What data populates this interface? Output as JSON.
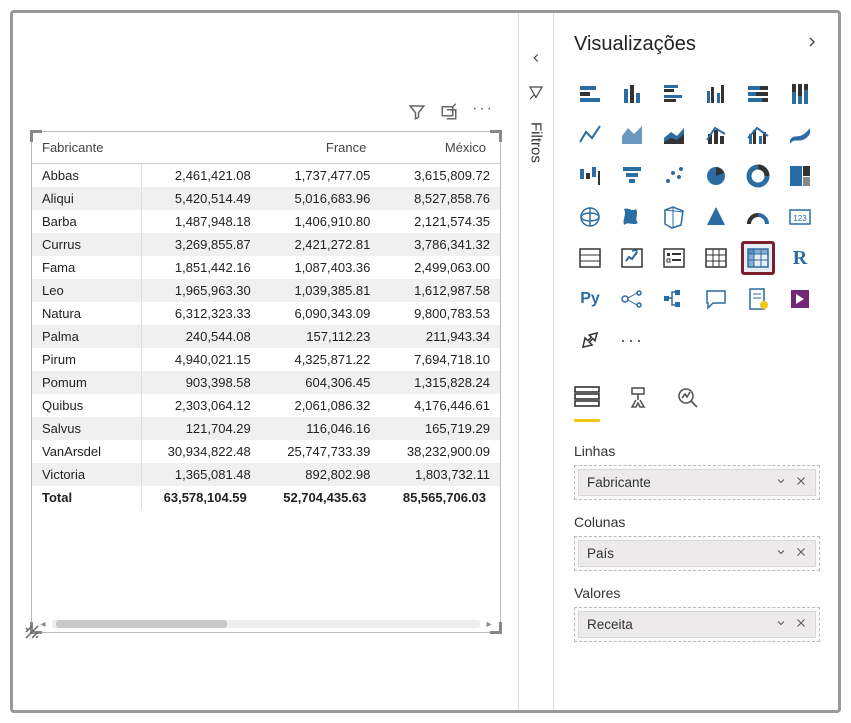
{
  "filtersTab": {
    "label": "Filtros"
  },
  "vizPane": {
    "title": "Visualizações",
    "tabs": {
      "fields": "Campos",
      "format": "Formato",
      "analytics": "Análise"
    },
    "sections": {
      "rows": {
        "label": "Linhas",
        "field": "Fabricante"
      },
      "cols": {
        "label": "Colunas",
        "field": "País"
      },
      "vals": {
        "label": "Valores",
        "field": "Receita"
      }
    }
  },
  "matrix": {
    "rowHeader": "Fabricante",
    "colHeaders": [
      "",
      "France",
      "México"
    ],
    "rows": [
      {
        "label": "Abbas",
        "v": [
          "2,461,421.08",
          "1,737,477.05",
          "3,615,809.72"
        ]
      },
      {
        "label": "Aliqui",
        "v": [
          "5,420,514.49",
          "5,016,683.96",
          "8,527,858.76"
        ]
      },
      {
        "label": "Barba",
        "v": [
          "1,487,948.18",
          "1,406,910.80",
          "2,121,574.35"
        ]
      },
      {
        "label": "Currus",
        "v": [
          "3,269,855.87",
          "2,421,272.81",
          "3,786,341.32"
        ]
      },
      {
        "label": "Fama",
        "v": [
          "1,851,442.16",
          "1,087,403.36",
          "2,499,063.00"
        ]
      },
      {
        "label": "Leo",
        "v": [
          "1,965,963.30",
          "1,039,385.81",
          "1,612,987.58"
        ]
      },
      {
        "label": "Natura",
        "v": [
          "6,312,323.33",
          "6,090,343.09",
          "9,800,783.53"
        ]
      },
      {
        "label": "Palma",
        "v": [
          "240,544.08",
          "157,112.23",
          "211,943.34"
        ]
      },
      {
        "label": "Pirum",
        "v": [
          "4,940,021.15",
          "4,325,871.22",
          "7,694,718.10"
        ]
      },
      {
        "label": "Pomum",
        "v": [
          "903,398.58",
          "604,306.45",
          "1,315,828.24"
        ]
      },
      {
        "label": "Quibus",
        "v": [
          "2,303,064.12",
          "2,061,086.32",
          "4,176,446.61"
        ]
      },
      {
        "label": "Salvus",
        "v": [
          "121,704.29",
          "116,046.16",
          "165,719.29"
        ]
      },
      {
        "label": "VanArsdel",
        "v": [
          "30,934,822.48",
          "25,747,733.39",
          "38,232,900.09"
        ]
      },
      {
        "label": "Victoria",
        "v": [
          "1,365,081.48",
          "892,802.98",
          "1,803,732.11"
        ]
      }
    ],
    "total": {
      "label": "Total",
      "v": [
        "63,578,104.59",
        "52,704,435.63",
        "85,565,706.03"
      ]
    }
  },
  "vizIcons": [
    "stacked-bar",
    "stacked-column",
    "clustered-bar",
    "clustered-column",
    "hundred-bar",
    "hundred-column",
    "line",
    "area",
    "stacked-area",
    "line-stacked-col",
    "line-clustered-col",
    "ribbon",
    "waterfall",
    "funnel",
    "scatter",
    "pie",
    "donut",
    "treemap",
    "map",
    "filled-map",
    "shape-map",
    "azure-map",
    "gauge",
    "card",
    "multirow-card",
    "kpi",
    "slicer",
    "table",
    "matrix",
    "r-visual",
    "python-visual",
    "key-influencers",
    "decomposition-tree",
    "qna",
    "paginated",
    "power-apps",
    "get-more",
    "more-options"
  ]
}
